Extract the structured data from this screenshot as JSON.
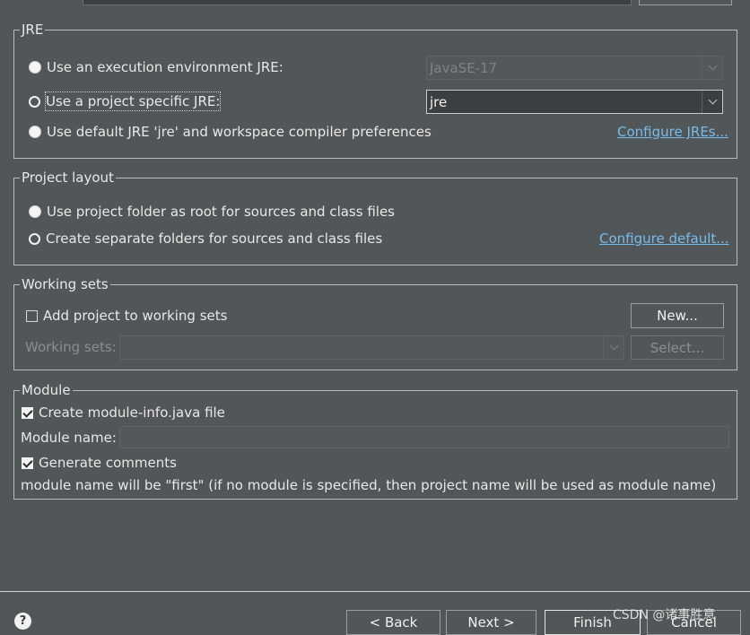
{
  "top_partial": {},
  "jre": {
    "legend": "JRE",
    "opt_env": "Use an execution environment JRE:",
    "env_value": "JavaSE-17",
    "opt_project": "Use a project specific JRE:",
    "project_value": "jre",
    "opt_default": "Use default JRE 'jre' and workspace compiler preferences",
    "configure_link": "Configure JREs..."
  },
  "layout": {
    "legend": "Project layout",
    "opt_root": "Use project folder as root for sources and class files",
    "opt_separate": "Create separate folders for sources and class files",
    "configure_link": "Configure default..."
  },
  "working_sets": {
    "legend": "Working sets",
    "add_label": "Add project to working sets",
    "new_button": "New...",
    "sets_label": "Working sets:",
    "select_button": "Select..."
  },
  "module": {
    "legend": "Module",
    "create_label": "Create module-info.java file",
    "name_label": "Module name:",
    "comments_label": "Generate comments",
    "info_text": "module name will be \"first\"  (if no module is specified, then project name will be used as module name)"
  },
  "footer": {
    "help_glyph": "?",
    "back": "< Back",
    "next": "Next >",
    "finish": "Finish",
    "cancel": "Cancel",
    "watermark": "CSDN @诸事胜意"
  },
  "colors": {
    "background": "#515658",
    "link": "#79bbea",
    "input_bg": "#3c3f41"
  }
}
